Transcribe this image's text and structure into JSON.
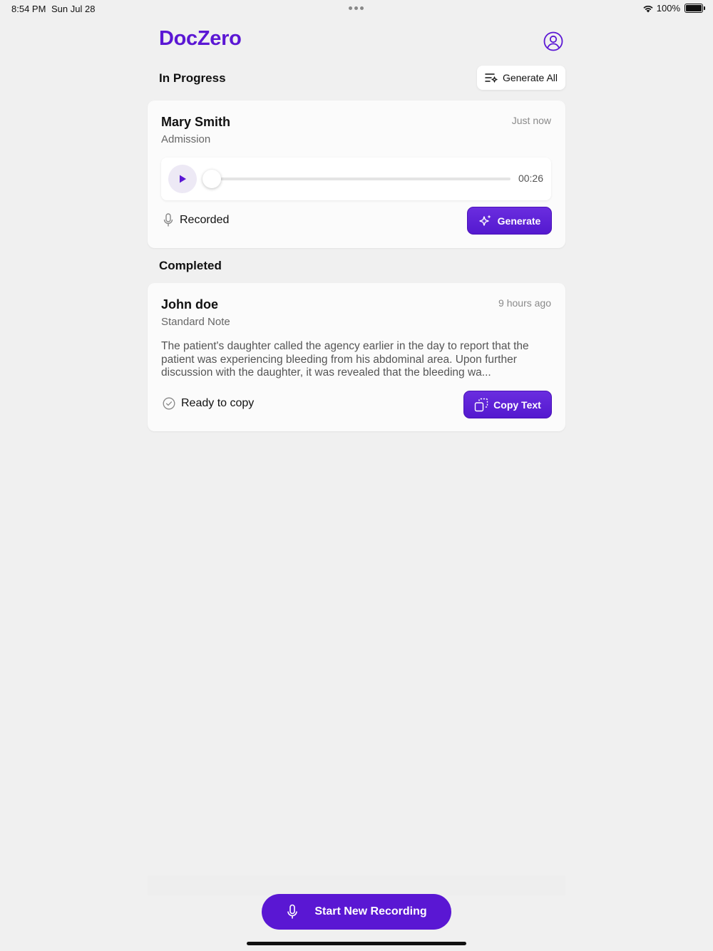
{
  "status_bar": {
    "time": "8:54 PM",
    "date": "Sun Jul 28",
    "battery": "100%",
    "battery_level": 1.0
  },
  "header": {
    "app_title": "DocZero",
    "profile_icon": "user-circle-icon"
  },
  "in_progress": {
    "section_title": "In Progress",
    "generate_all_label": "Generate All",
    "cards": [
      {
        "name": "Mary Smith",
        "type": "Admission",
        "time": "Just now",
        "duration": "00:26",
        "playback_progress": 0.0,
        "status": "Recorded",
        "action_label": "Generate"
      }
    ]
  },
  "completed": {
    "section_title": "Completed",
    "cards": [
      {
        "name": "John doe",
        "type": "Standard Note",
        "time": "9 hours ago",
        "preview": "The patient's daughter called the agency earlier in the day to report that the patient was experiencing bleeding from his abdominal area. Upon further discussion with the daughter, it was revealed that the bleeding wa...",
        "status": "Ready to copy",
        "action_label": "Copy Text"
      }
    ]
  },
  "footer": {
    "record_label": "Start New Recording"
  },
  "colors": {
    "accent": "#5b17d4",
    "background": "#f0f0f0",
    "card": "#fbfbfb"
  }
}
